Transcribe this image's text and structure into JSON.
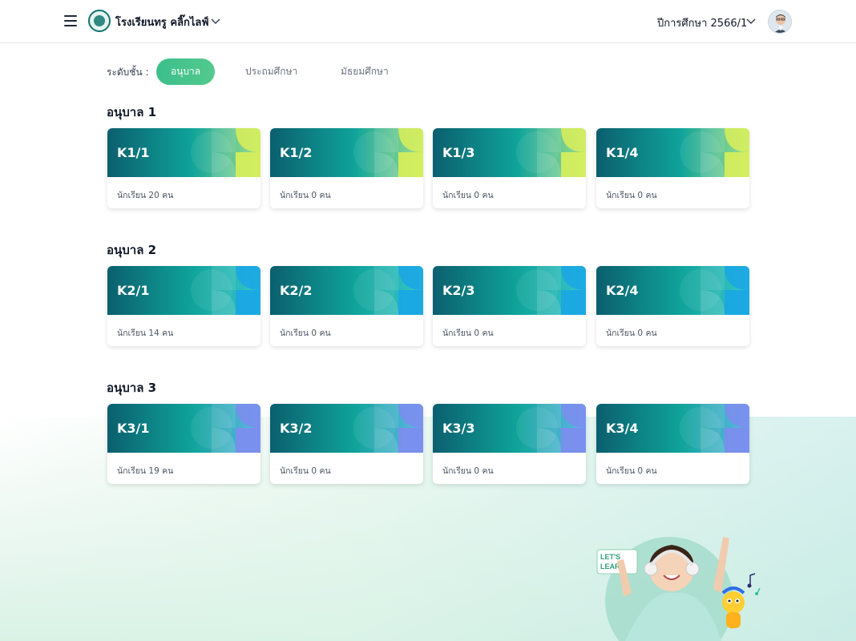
{
  "header": {
    "school_name": "โรงเรียนทรู คลิ๊กไลฟ์",
    "academic_year": "ปีการศึกษา 2566/1"
  },
  "filter": {
    "label": "ระดับชั้น :",
    "options": [
      "อนุบาล",
      "ประถมศึกษา",
      "มัธยมศึกษา"
    ],
    "selected": "อนุบาล"
  },
  "sections": [
    {
      "title": "อนุบาล 1",
      "theme": "lime",
      "rooms": [
        {
          "code": "K1/1",
          "count": "นักเรียน 20 คน"
        },
        {
          "code": "K1/2",
          "count": "นักเรียน 0 คน"
        },
        {
          "code": "K1/3",
          "count": "นักเรียน 0 คน"
        },
        {
          "code": "K1/4",
          "count": "นักเรียน 0 คน"
        }
      ]
    },
    {
      "title": "อนุบาล 2",
      "theme": "blue",
      "rooms": [
        {
          "code": "K2/1",
          "count": "นักเรียน 14 คน"
        },
        {
          "code": "K2/2",
          "count": "นักเรียน 0 คน"
        },
        {
          "code": "K2/3",
          "count": "นักเรียน 0 คน"
        },
        {
          "code": "K2/4",
          "count": "นักเรียน 0 คน"
        }
      ]
    },
    {
      "title": "อนุบาล 3",
      "theme": "violet",
      "rooms": [
        {
          "code": "K3/1",
          "count": "นักเรียน 19 คน"
        },
        {
          "code": "K3/2",
          "count": "นักเรียน 0 คน"
        },
        {
          "code": "K3/3",
          "count": "นักเรียน 0 คน"
        },
        {
          "code": "K3/4",
          "count": "นักเรียน 0 คน"
        }
      ]
    }
  ],
  "illustration": {
    "badge_text": "LET'S LEARN"
  },
  "colors": {
    "accent": "#3cbf8c",
    "card_teal_dark": "#0b5f6e",
    "card_teal_mid": "#0fa39a",
    "lime": "#d9ef5a",
    "blue": "#1aa6e6",
    "violet": "#7e8cf0"
  },
  "icons": {
    "menu": "hamburger-menu-icon",
    "chevron": "chevron-down-icon",
    "user": "user-avatar"
  }
}
